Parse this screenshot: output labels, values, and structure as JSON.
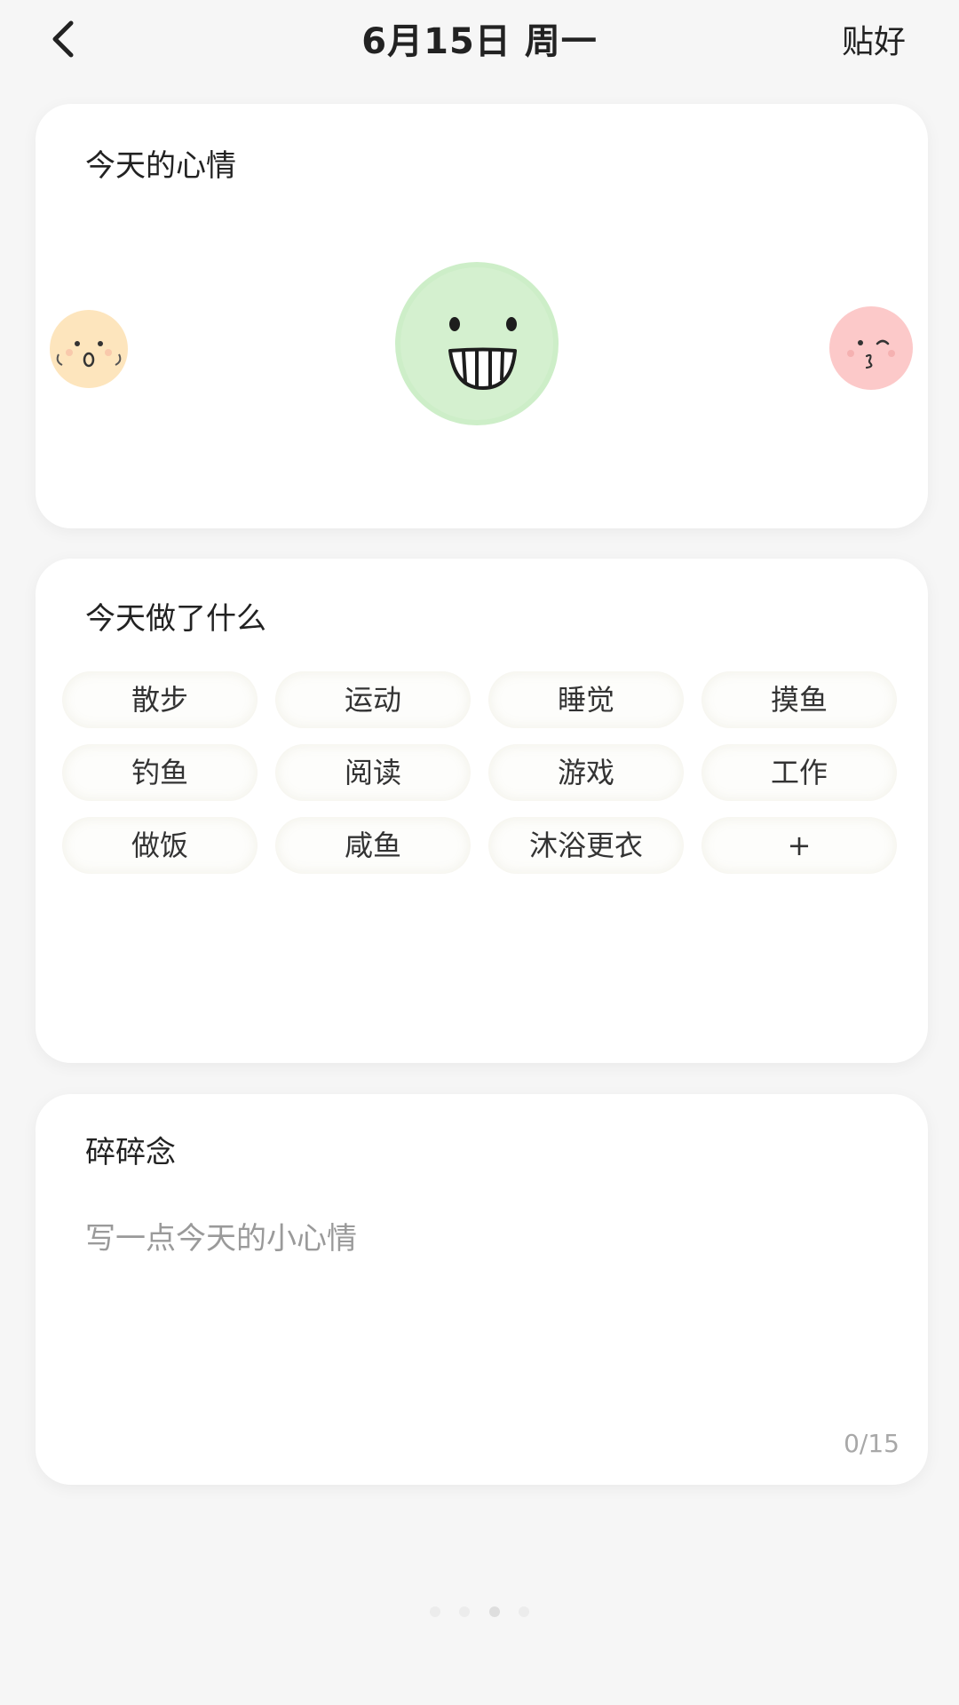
{
  "header": {
    "title": "6月15日 周一",
    "done_label": "贴好"
  },
  "mood_section": {
    "title": "今天的心情",
    "moods": [
      {
        "name": "surprised",
        "color": "#fde0b2",
        "selected": false
      },
      {
        "name": "grinning",
        "color": "#cfeeca",
        "selected": true
      },
      {
        "name": "kissing-wink",
        "color": "#fcc8c8",
        "selected": false
      }
    ]
  },
  "activity_section": {
    "title": "今天做了什么",
    "tags": [
      "散步",
      "运动",
      "睡觉",
      "摸鱼",
      "钓鱼",
      "阅读",
      "游戏",
      "工作",
      "做饭",
      "咸鱼",
      "沐浴更衣"
    ],
    "add_label": "+"
  },
  "notes_section": {
    "title": "碎碎念",
    "placeholder": "写一点今天的小心情",
    "value": "",
    "char_count": "0/15"
  },
  "pager": {
    "total": 4,
    "active": 2
  }
}
